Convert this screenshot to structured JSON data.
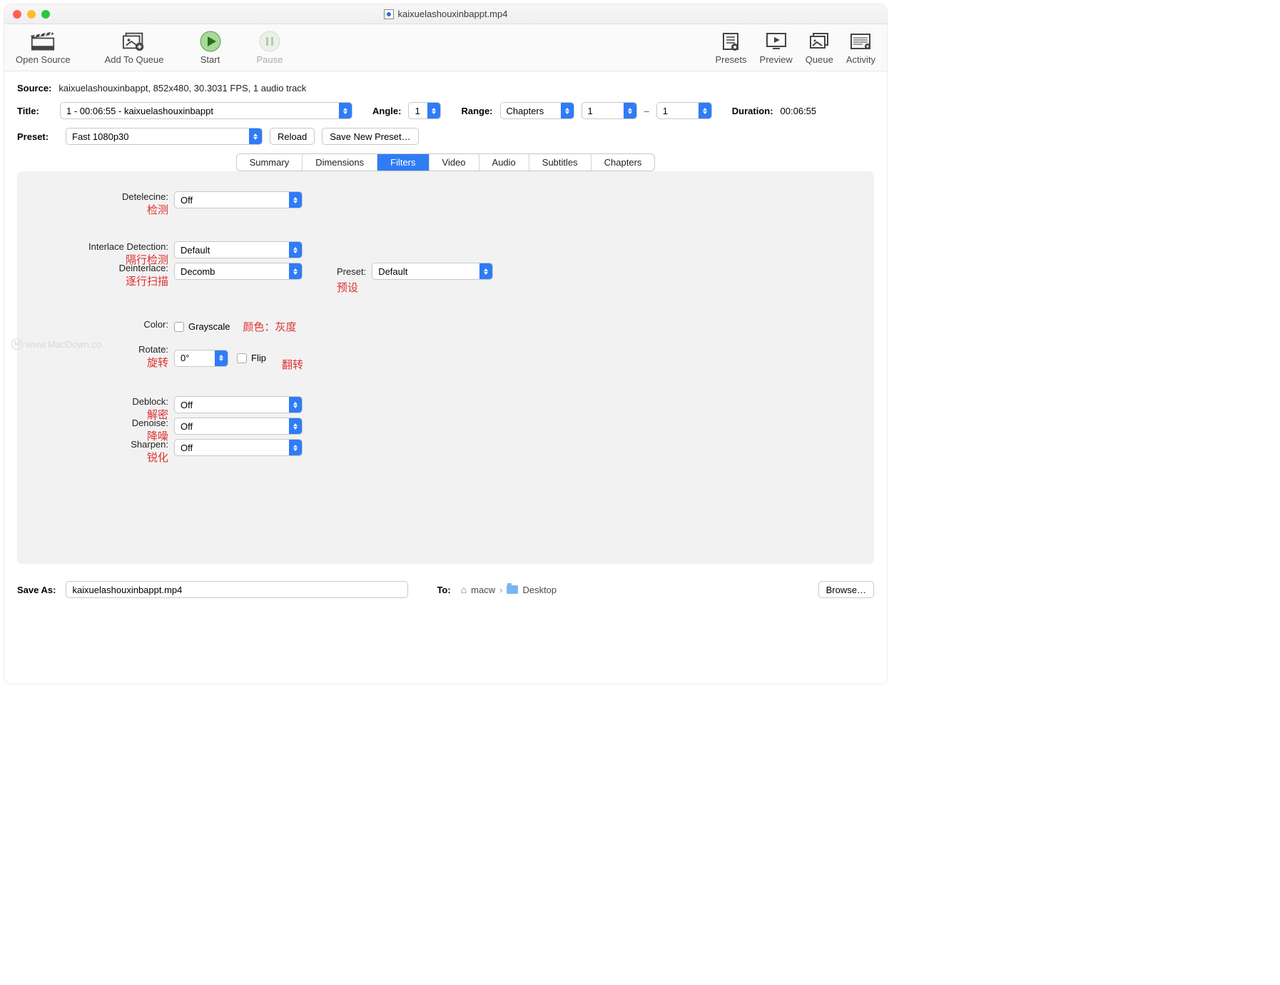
{
  "window": {
    "title": "kaixuelashouxinbappt.mp4"
  },
  "toolbar": {
    "open_source": "Open Source",
    "add_to_queue": "Add To Queue",
    "start": "Start",
    "pause": "Pause",
    "presets": "Presets",
    "preview": "Preview",
    "queue": "Queue",
    "activity": "Activity"
  },
  "source": {
    "label": "Source:",
    "value": "kaixuelashouxinbappt, 852x480, 30.3031 FPS, 1 audio track"
  },
  "title_row": {
    "label": "Title:",
    "value": "1 - 00:06:55 - kaixuelashouxinbappt",
    "angle_label": "Angle:",
    "angle_value": "1",
    "range_label": "Range:",
    "range_type": "Chapters",
    "range_from": "1",
    "range_dash": "–",
    "range_to": "1",
    "duration_label": "Duration:",
    "duration_value": "00:06:55"
  },
  "preset_row": {
    "label": "Preset:",
    "value": "Fast 1080p30",
    "reload": "Reload",
    "save_new": "Save New Preset…"
  },
  "tabs": [
    "Summary",
    "Dimensions",
    "Filters",
    "Video",
    "Audio",
    "Subtitles",
    "Chapters"
  ],
  "active_tab": "Filters",
  "filters": {
    "detelecine": {
      "label": "Detelecine:",
      "value": "Off",
      "anno": "检测"
    },
    "interlace_detection": {
      "label": "Interlace Detection:",
      "value": "Default",
      "anno": "隔行检测"
    },
    "deinterlace": {
      "label": "Deinterlace:",
      "value": "Decomb",
      "anno": "逐行扫描"
    },
    "deint_preset": {
      "label": "Preset:",
      "value": "Default",
      "anno": "预设"
    },
    "color": {
      "label": "Color:",
      "grayscale": "Grayscale",
      "anno": "颜色：灰度"
    },
    "rotate": {
      "label": "Rotate:",
      "value": "0°",
      "flip": "Flip",
      "anno": "旋转",
      "anno2": "翻转"
    },
    "deblock": {
      "label": "Deblock:",
      "value": "Off",
      "anno": "解密"
    },
    "denoise": {
      "label": "Denoise:",
      "value": "Off",
      "anno": "降噪"
    },
    "sharpen": {
      "label": "Sharpen:",
      "value": "Off",
      "anno": "锐化"
    }
  },
  "save": {
    "label": "Save As:",
    "filename": "kaixuelashouxinbappt.mp4",
    "to_label": "To:",
    "path1": "macw",
    "path2": "Desktop",
    "browse": "Browse…"
  },
  "watermark": "www.MacDown.co"
}
